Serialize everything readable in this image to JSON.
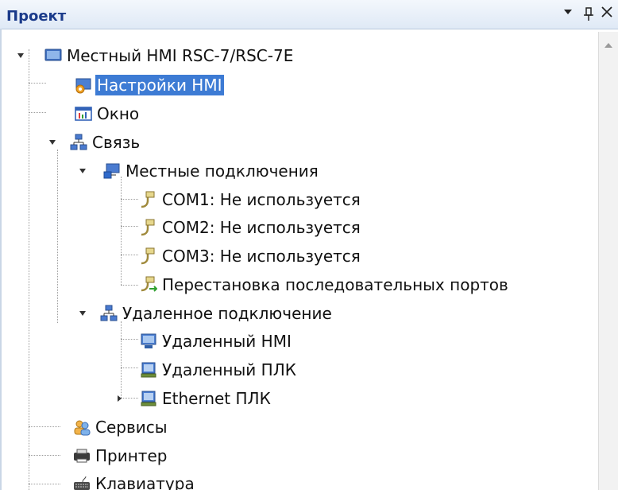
{
  "panel": {
    "title": "Проект"
  },
  "tree": {
    "items": [
      {
        "label": "Местный HMI RSC-7/RSC-7E",
        "icon": "monitor-icon"
      },
      {
        "label": "Настройки HMI",
        "icon": "hmi-settings-icon",
        "selected": true
      },
      {
        "label": "Окно",
        "icon": "window-icon"
      },
      {
        "label": "Связь",
        "icon": "network-icon"
      },
      {
        "label": "Местные подключения",
        "icon": "local-connection-icon"
      },
      {
        "label": "COM1: Не используется",
        "icon": "serial-port-icon"
      },
      {
        "label": "COM2: Не используется",
        "icon": "serial-port-icon"
      },
      {
        "label": "COM3: Не используется",
        "icon": "serial-port-icon"
      },
      {
        "label": "Перестановка последовательных портов",
        "icon": "port-swap-icon"
      },
      {
        "label": "Удаленное подключение",
        "icon": "network-icon"
      },
      {
        "label": "Удаленный HMI",
        "icon": "remote-hmi-icon"
      },
      {
        "label": "Удаленный ПЛК",
        "icon": "plc-icon"
      },
      {
        "label": "Ethernet ПЛК",
        "icon": "plc-icon"
      },
      {
        "label": "Сервисы",
        "icon": "services-icon"
      },
      {
        "label": "Принтер",
        "icon": "printer-icon"
      },
      {
        "label": "Клавиатура",
        "icon": "keyboard-icon"
      }
    ]
  },
  "colors": {
    "selection": "#3d7bd4",
    "title": "#1a3a8a",
    "header": "#dfe9f6"
  }
}
